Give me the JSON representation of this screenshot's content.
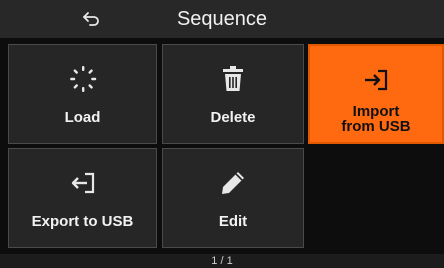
{
  "header": {
    "title": "Sequence",
    "back_icon": "back-arrow-icon"
  },
  "tiles": [
    {
      "label": "Load",
      "icon": "load-spinner-icon"
    },
    {
      "label": "Delete",
      "icon": "trash-icon"
    },
    {
      "label_line1": "Import",
      "label_line2": "from USB",
      "icon": "import-icon",
      "selected": true
    },
    {
      "label": "Export to USB",
      "icon": "export-icon"
    },
    {
      "label": "Edit",
      "icon": "pencil-icon"
    }
  ],
  "footer": {
    "page": "1 / 1"
  },
  "colors": {
    "accent": "#ff6a10",
    "tile": "#262626",
    "header": "#282828",
    "background": "#0d0d0d"
  }
}
